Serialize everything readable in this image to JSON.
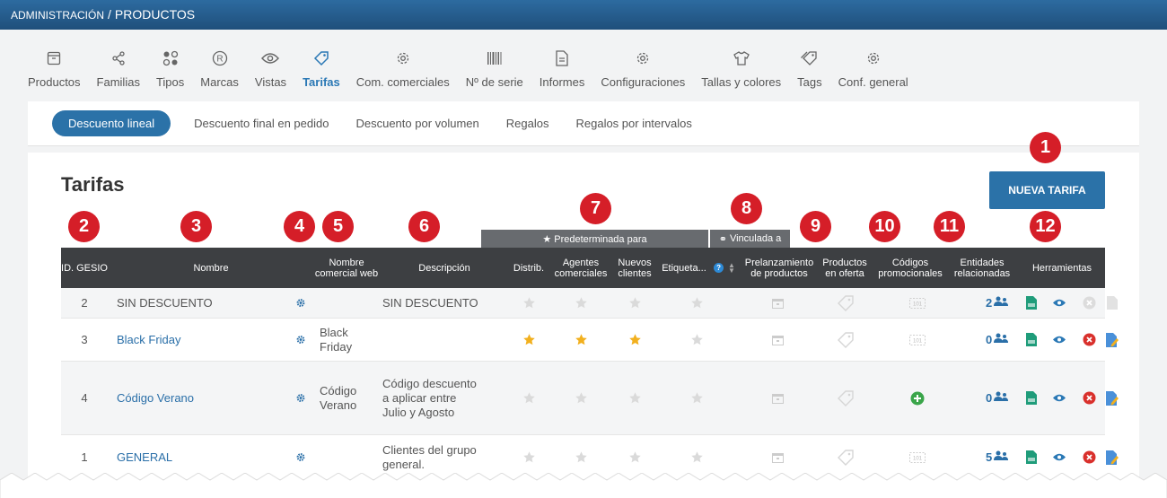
{
  "breadcrumb": {
    "section": "ADMINISTRACIÓN",
    "separator": "/",
    "page": "PRODUCTOS"
  },
  "modules": [
    {
      "label": "Productos",
      "icon": "box-icon"
    },
    {
      "label": "Familias",
      "icon": "share-icon"
    },
    {
      "label": "Tipos",
      "icon": "shapes-icon"
    },
    {
      "label": "Marcas",
      "icon": "registered-icon"
    },
    {
      "label": "Vistas",
      "icon": "eye-icon"
    },
    {
      "label": "Tarifas",
      "icon": "tag-icon",
      "active": true
    },
    {
      "label": "Com. comerciales",
      "icon": "gear-icon"
    },
    {
      "label": "Nº de serie",
      "icon": "barcode-icon"
    },
    {
      "label": "Informes",
      "icon": "document-icon"
    },
    {
      "label": "Configuraciones",
      "icon": "gear-icon"
    },
    {
      "label": "Tallas y colores",
      "icon": "tshirt-icon"
    },
    {
      "label": "Tags",
      "icon": "tags-icon"
    },
    {
      "label": "Conf. general",
      "icon": "gear-icon"
    }
  ],
  "subtabs": [
    "Descuento lineal",
    "Descuento final en pedido",
    "Descuento por volumen",
    "Regalos",
    "Regalos por intervalos"
  ],
  "page": {
    "title": "Tarifas",
    "new_button": "NUEVA TARIFA"
  },
  "callouts": [
    "1",
    "2",
    "3",
    "4",
    "5",
    "6",
    "7",
    "8",
    "9",
    "10",
    "11",
    "12"
  ],
  "table": {
    "group_predeterminada": "★ Predeterminada para",
    "group_vinculada": "Vinculada a",
    "headers": {
      "id": "ID. GESIO",
      "nombre": "Nombre",
      "comercial": "Nombre comercial web",
      "descripcion": "Descripción",
      "distrib": "Distrib.",
      "agentes": "Agentes comerciales",
      "nuevos": "Nuevos clientes",
      "etiquetas": "Etiqueta...",
      "prelanzamiento": "Prelanzamiento de productos",
      "oferta": "Productos en oferta",
      "codigos": "Códigos promocionales",
      "entidades": "Entidades relacionadas",
      "herramientas": "Herramientas"
    },
    "rows": [
      {
        "id": "2",
        "nombre": "SIN DESCUENTO",
        "comercial": "",
        "descripcion": "SIN DESCUENTO",
        "stars": [
          false,
          false,
          false,
          false
        ],
        "codigo_activo": false,
        "entidades": "2",
        "deletable": false
      },
      {
        "id": "3",
        "nombre": "Black Friday",
        "comercial": "Black Friday",
        "descripcion": "",
        "stars": [
          true,
          true,
          true,
          false
        ],
        "codigo_activo": false,
        "entidades": "0",
        "deletable": true
      },
      {
        "id": "4",
        "nombre": "Código Verano",
        "comercial": "Código Verano",
        "descripcion": "Código descuento a aplicar entre Julio y Agosto",
        "stars": [
          false,
          false,
          false,
          false
        ],
        "codigo_activo": true,
        "entidades": "0",
        "deletable": true
      },
      {
        "id": "1",
        "nombre": "GENERAL",
        "comercial": "",
        "descripcion": "Clientes del grupo general.",
        "stars": [
          false,
          false,
          false,
          false
        ],
        "codigo_activo": false,
        "entidades": "5",
        "deletable": true
      }
    ]
  },
  "colors": {
    "accent": "#2b72a8",
    "callout": "#d51e28",
    "star_on": "#f2b01e",
    "star_off": "#dadada"
  }
}
